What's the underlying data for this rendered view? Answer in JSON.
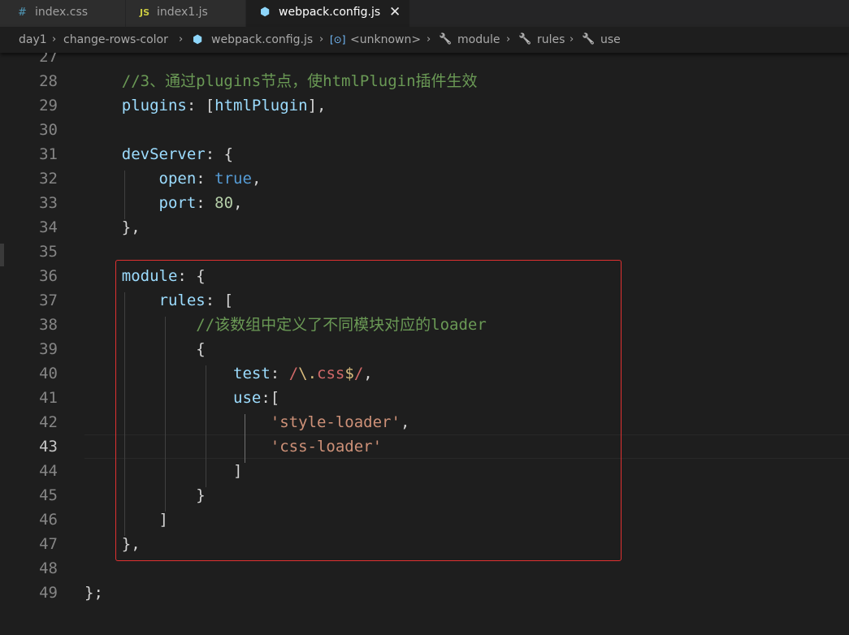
{
  "tabs": [
    {
      "icon": "#",
      "label": "index.css"
    },
    {
      "icon": "JS",
      "label": "index1.js"
    },
    {
      "icon": "⬢",
      "label": "webpack.config.js",
      "close": "✕"
    }
  ],
  "breadcrumb": {
    "items": [
      "day1",
      "change-rows-color",
      "webpack.config.js",
      "<unknown>",
      "module",
      "rules",
      "use"
    ],
    "icons": {
      "file": "⬢",
      "unknown": "[⊙]",
      "key": "🔧"
    },
    "separator": "›"
  },
  "editor": {
    "current_line": "43",
    "lines": [
      {
        "n": "27",
        "tokens": []
      },
      {
        "n": "28",
        "tokens": [
          {
            "t": "    "
          },
          {
            "t": "//3、通过plugins节点，使htmlPlugin插件生效",
            "c": "c"
          }
        ]
      },
      {
        "n": "29",
        "tokens": [
          {
            "t": "    "
          },
          {
            "t": "plugins",
            "c": "p"
          },
          {
            "t": ": [",
            "c": "d"
          },
          {
            "t": "htmlPlugin",
            "c": "p"
          },
          {
            "t": "],",
            "c": "d"
          }
        ]
      },
      {
        "n": "30",
        "tokens": []
      },
      {
        "n": "31",
        "tokens": [
          {
            "t": "    "
          },
          {
            "t": "devServer",
            "c": "p"
          },
          {
            "t": ": {",
            "c": "d"
          }
        ]
      },
      {
        "n": "32",
        "tokens": [
          {
            "t": "        "
          },
          {
            "t": "open",
            "c": "p"
          },
          {
            "t": ": ",
            "c": "d"
          },
          {
            "t": "true",
            "c": "k"
          },
          {
            "t": ",",
            "c": "d"
          }
        ]
      },
      {
        "n": "33",
        "tokens": [
          {
            "t": "        "
          },
          {
            "t": "port",
            "c": "p"
          },
          {
            "t": ": ",
            "c": "d"
          },
          {
            "t": "80",
            "c": "n"
          },
          {
            "t": ",",
            "c": "d"
          }
        ]
      },
      {
        "n": "34",
        "tokens": [
          {
            "t": "    "
          },
          {
            "t": "},",
            "c": "d"
          }
        ]
      },
      {
        "n": "35",
        "tokens": []
      },
      {
        "n": "36",
        "tokens": [
          {
            "t": "    "
          },
          {
            "t": "module",
            "c": "p"
          },
          {
            "t": ": {",
            "c": "d"
          }
        ]
      },
      {
        "n": "37",
        "tokens": [
          {
            "t": "        "
          },
          {
            "t": "rules",
            "c": "p"
          },
          {
            "t": ": [",
            "c": "d"
          }
        ]
      },
      {
        "n": "38",
        "tokens": [
          {
            "t": "            "
          },
          {
            "t": "//该数组中定义了不同模块对应的loader",
            "c": "c"
          }
        ]
      },
      {
        "n": "39",
        "tokens": [
          {
            "t": "            "
          },
          {
            "t": "{",
            "c": "d"
          }
        ]
      },
      {
        "n": "40",
        "tokens": [
          {
            "t": "                "
          },
          {
            "t": "test",
            "c": "p"
          },
          {
            "t": ": ",
            "c": "d"
          },
          {
            "t": "/",
            "c": "r"
          },
          {
            "t": "\\.",
            "c": "e"
          },
          {
            "t": "css",
            "c": "r"
          },
          {
            "t": "$",
            "c": "e"
          },
          {
            "t": "/",
            "c": "r"
          },
          {
            "t": ",",
            "c": "d"
          }
        ]
      },
      {
        "n": "41",
        "tokens": [
          {
            "t": "                "
          },
          {
            "t": "use",
            "c": "p"
          },
          {
            "t": ":[",
            "c": "d"
          }
        ]
      },
      {
        "n": "42",
        "tokens": [
          {
            "t": "                    "
          },
          {
            "t": "'style-loader'",
            "c": "s"
          },
          {
            "t": ",",
            "c": "d"
          }
        ]
      },
      {
        "n": "43",
        "tokens": [
          {
            "t": "                    "
          },
          {
            "t": "'css-loader'",
            "c": "s"
          }
        ]
      },
      {
        "n": "44",
        "tokens": [
          {
            "t": "                "
          },
          {
            "t": "]",
            "c": "d"
          }
        ]
      },
      {
        "n": "45",
        "tokens": [
          {
            "t": "            "
          },
          {
            "t": "}",
            "c": "d"
          }
        ]
      },
      {
        "n": "46",
        "tokens": [
          {
            "t": "        "
          },
          {
            "t": "]",
            "c": "d"
          }
        ]
      },
      {
        "n": "47",
        "tokens": [
          {
            "t": "    "
          },
          {
            "t": "},",
            "c": "d"
          }
        ]
      },
      {
        "n": "48",
        "tokens": []
      },
      {
        "n": "49",
        "tokens": [
          {
            "t": "};",
            "c": "d"
          }
        ]
      }
    ]
  },
  "colors": {
    "background": "#1e1e1e",
    "property": "#9cdcfe",
    "comment": "#6a9955",
    "number": "#b5cea8",
    "keyword": "#569cd6",
    "string": "#ce9178",
    "regex": "#d16969",
    "highlight_box": "#e03131"
  }
}
